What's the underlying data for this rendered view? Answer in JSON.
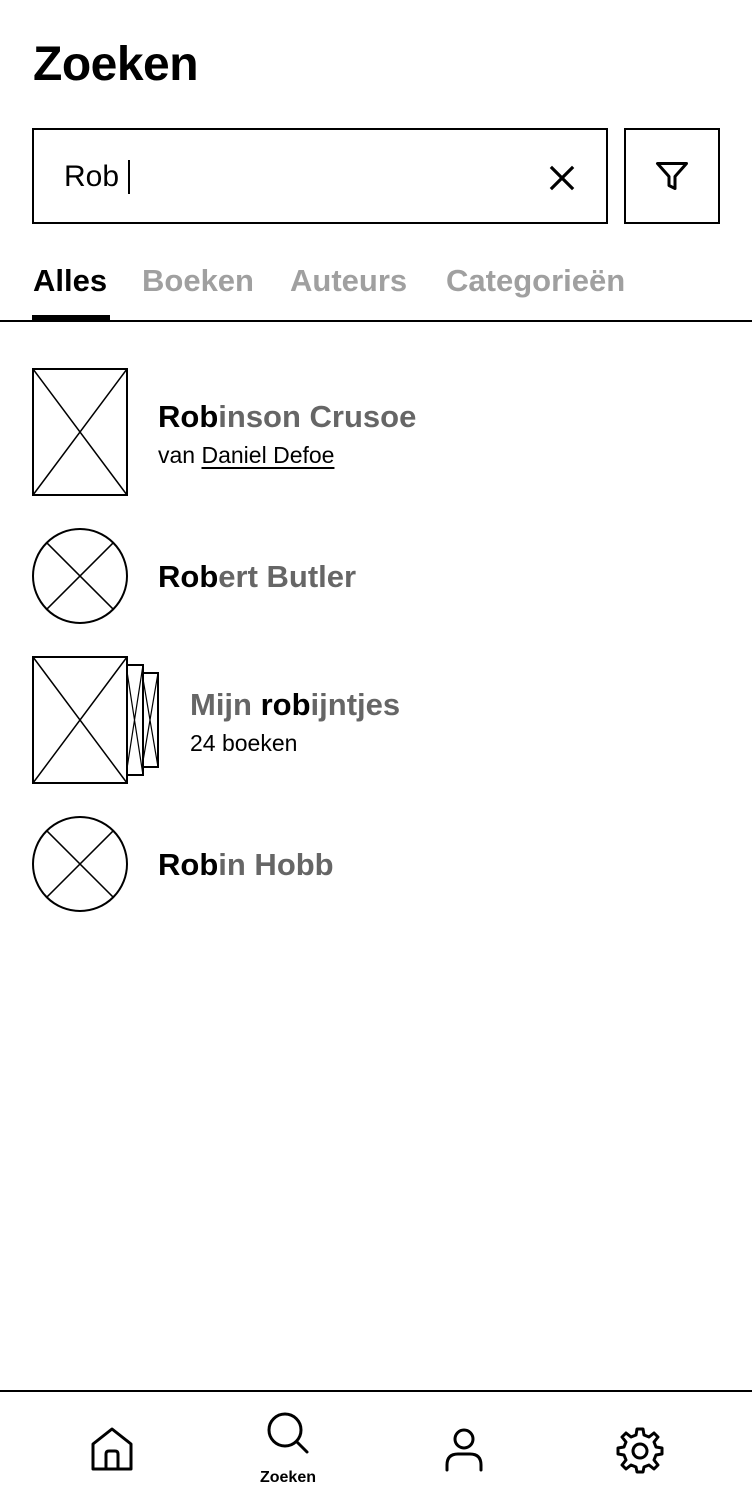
{
  "header": {
    "title": "Zoeken"
  },
  "search": {
    "value": "Rob"
  },
  "tabs": [
    {
      "label": "Alles",
      "active": true
    },
    {
      "label": "Boeken",
      "active": false
    },
    {
      "label": "Auteurs",
      "active": false
    },
    {
      "label": "Categorieën",
      "active": false
    }
  ],
  "results": [
    {
      "kind": "book",
      "title_match": "Rob",
      "title_rest": "inson Crusoe",
      "sub_prefix": "van ",
      "sub_link": "Daniel Defoe"
    },
    {
      "kind": "author",
      "title_match": "Rob",
      "title_rest": "ert Butler"
    },
    {
      "kind": "collection",
      "title_pre": "Mijn ",
      "title_match": "rob",
      "title_rest": "ijntjes",
      "subtitle": "24 boeken"
    },
    {
      "kind": "author",
      "title_match": "Rob",
      "title_rest": "in Hobb"
    }
  ],
  "bottom_nav": [
    {
      "icon": "home-icon",
      "label": ""
    },
    {
      "icon": "search-icon",
      "label": "Zoeken",
      "active": true
    },
    {
      "icon": "profile-icon",
      "label": ""
    },
    {
      "icon": "settings-icon",
      "label": ""
    }
  ]
}
